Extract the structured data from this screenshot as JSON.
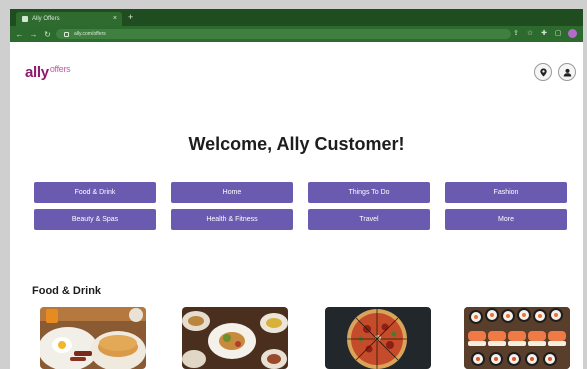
{
  "browser": {
    "tab_title": "Ally Offers",
    "tab_close": "×",
    "new_tab": "+",
    "url": "ally.com/offers",
    "accent": "#1f4d1f"
  },
  "header": {
    "logo_main": "ally",
    "logo_sup": "offers",
    "location_icon": "map-pin-icon",
    "account_icon": "user-icon"
  },
  "main": {
    "welcome": "Welcome, Ally Customer!",
    "categories": [
      "Food & Drink",
      "Home",
      "Things To Do",
      "Fashion",
      "Beauty & Spas",
      "Health & Fitness",
      "Travel",
      "More"
    ],
    "section_title": "Food & Drink",
    "cards": [
      {
        "name": "breakfast-image"
      },
      {
        "name": "dinner-plate-image"
      },
      {
        "name": "pizza-image"
      },
      {
        "name": "sushi-image"
      }
    ]
  },
  "colors": {
    "button": "#6a5bb0",
    "logo": "#8e1a6c"
  }
}
